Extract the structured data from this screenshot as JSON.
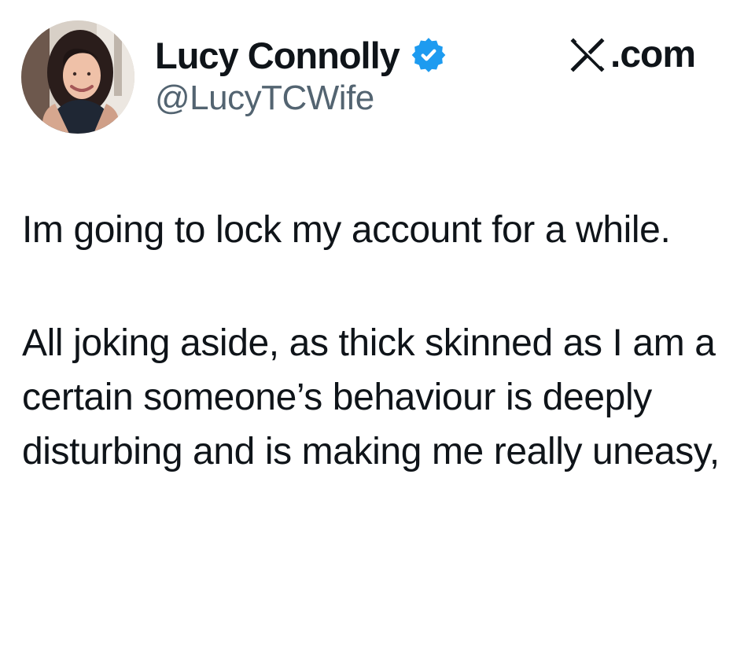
{
  "tweet": {
    "author": {
      "name": "Lucy Connolly",
      "handle": "@LucyTCWife",
      "verified": true,
      "verified_color": "#1d9bf0"
    },
    "source": {
      "text": ".com",
      "logo_icon": "x-logo-icon"
    },
    "paragraphs": [
      "Im going to lock my account for a while.",
      "All joking aside, as thick skinned as I am a certain someone’s behaviour is deeply disturbing and is making me really uneasy,"
    ]
  },
  "colors": {
    "background": "#ffffff",
    "primary_text": "#0f1419",
    "secondary_text": "#536471",
    "verified_badge": "#1d9bf0"
  }
}
